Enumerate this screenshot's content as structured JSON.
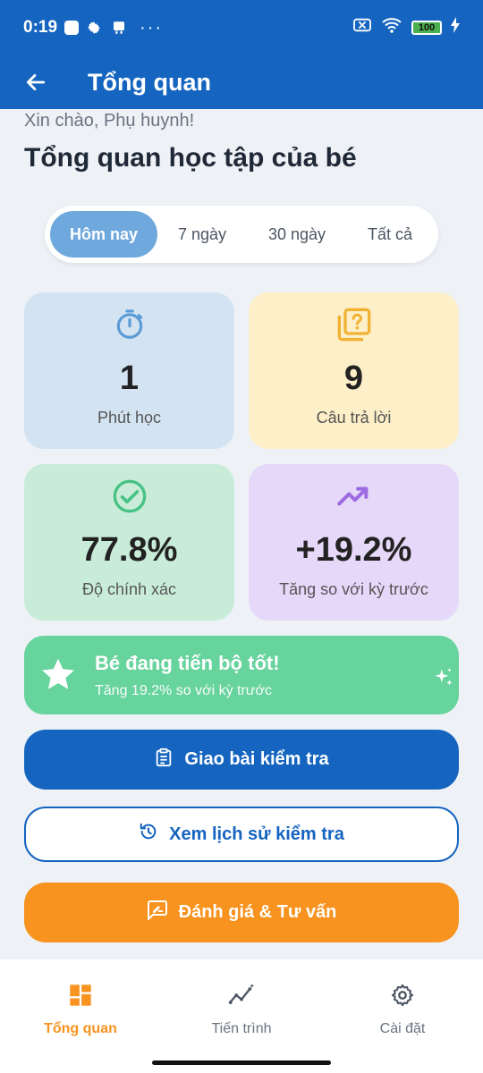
{
  "status_bar": {
    "time": "0:19",
    "battery": "100",
    "overflow": "···"
  },
  "app_bar": {
    "title": "Tổng quan"
  },
  "header": {
    "greeting": "Xin chào, Phụ huynh!",
    "title": "Tổng quan học tập của bé"
  },
  "period_tabs": {
    "selected": "Hôm nay",
    "items": [
      "Hôm nay",
      "7 ngày",
      "30 ngày",
      "Tất cả"
    ]
  },
  "stats": [
    {
      "value": "1",
      "label": "Phút học",
      "icon": "timer-icon",
      "color": "#5b9bd5"
    },
    {
      "value": "9",
      "label": "Câu trả lời",
      "icon": "quiz-icon",
      "color": "#f2b233"
    },
    {
      "value": "77.8%",
      "label": "Độ chính xác",
      "icon": "check-circle-icon",
      "color": "#46c285"
    },
    {
      "value": "+19.2%",
      "label": "Tăng so với kỳ trước",
      "icon": "trending-up-icon",
      "color": "#9b6ae0"
    }
  ],
  "progress_banner": {
    "title": "Bé đang tiến bộ tốt!",
    "subtitle": "Tăng 19.2% so với kỳ trước"
  },
  "actions": {
    "assign_test": "Giao bài kiểm tra",
    "view_history": "Xem lịch sử kiểm tra",
    "evaluate": "Đánh giá & Tư vấn"
  },
  "bottom_nav": {
    "active": "Tổng quan",
    "items": [
      "Tổng quan",
      "Tiến trình",
      "Cài đặt"
    ]
  },
  "colors": {
    "primary": "#1565c0",
    "accent": "#f7931e",
    "success": "#67d39d"
  }
}
